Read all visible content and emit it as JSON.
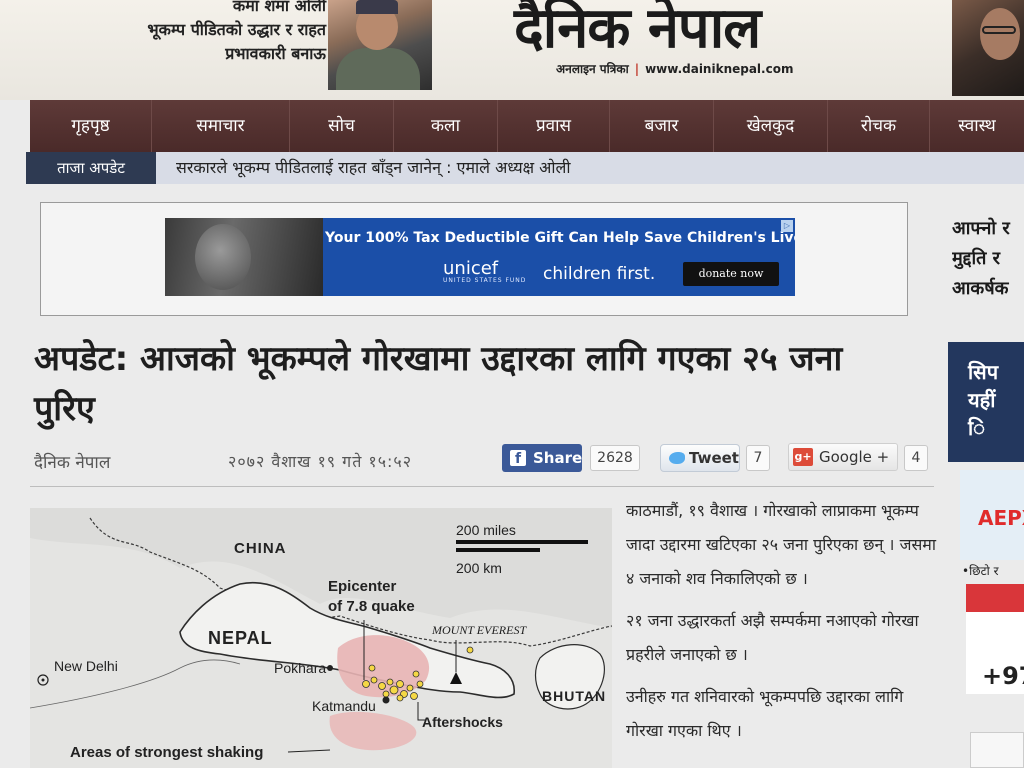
{
  "header": {
    "teaser_line_top": "कमा शमा ओली",
    "teaser_line_1": "भूकम्प पीडितको उद्धार र राहत",
    "teaser_line_2": "प्रभावकारी बनाऊ",
    "logo": "दैनिक नेपाल",
    "tagline_left": "अनलाइन पत्रिका",
    "tagline_sep": "|",
    "tagline_url": "www.dainiknepal.com"
  },
  "nav": {
    "items": [
      "गृहपृष्ठ",
      "समाचार",
      "सोच",
      "कला",
      "प्रवास",
      "बजार",
      "खेलकुद",
      "रोचक",
      "स्वास्थ"
    ]
  },
  "ticker": {
    "label": "ताजा अपडेट",
    "text": "सरकारले भूकम्प पीडितलाई राहत बाँड्न जानेन् : एमाले अध्यक्ष ओली"
  },
  "ad": {
    "headline": "Your 100% Tax Deductible Gift Can Help Save Children's Lives.",
    "brand": "unicef",
    "brand_sub": "UNITED STATES FUND",
    "slogan": "children first.",
    "button": "donate now",
    "choice_icon": "▷"
  },
  "article": {
    "headline": "अपडेट: आजको भूकम्पले गोरखामा उद्दारका लागि गएका २५ जना पुरिए",
    "source": "दैनिक नेपाल",
    "date": "२०७२ वैशाख १९ गते १५:५२",
    "paragraphs": [
      "काठमाडौं, १९ वैशाख । गोरखाको लाप्राकमा भूकम्प जादा उद्दारमा खटिएका २५ जना पुरिएका छन् । जसमा ४ जनाको शव निकालिएको छ ।",
      "२१ जना उद्धारकर्ता अझै सम्पर्कमा नआएको गोरखा प्रहरीले जनाएको छ ।",
      "उनीहरु गत शनिवारको भूकम्पपछि उद्दारका लागि गोरखा गएका थिए ।"
    ]
  },
  "share": {
    "facebook_label": "Share",
    "facebook_icon": "f",
    "facebook_count": "2628",
    "tweet_label": "Tweet",
    "tweet_count": "7",
    "gplus_icon": "g+",
    "gplus_label": "Google +",
    "gplus_count": "4"
  },
  "map": {
    "china": "CHINA",
    "nepal": "NEPAL",
    "new_delhi": "New Delhi",
    "pokhara": "Pokhara",
    "kathmandu": "Katmandu",
    "epicenter_1": "Epicenter",
    "epicenter_2": "of 7.8 quake",
    "everest": "MOUNT EVEREST",
    "aftershocks": "Aftershocks",
    "bhutan": "BHUTAN",
    "shaking": "Areas of strongest shaking",
    "scale_miles": "200 miles",
    "scale_km": "200 km"
  },
  "sidebar": {
    "teaser_1": "आफ्नो र",
    "teaser_2": "मुद्दति र",
    "teaser_3": "आकर्षक",
    "ad1_line1": "सिप",
    "ad1_line2": "यहीं",
    "ad1_line3": "ि",
    "ad2": "AEPX",
    "note": "•छिटो र",
    "ad3": "+97"
  },
  "colors": {
    "nav_bg": "#4a2a29",
    "ticker_label_bg": "#2e3a52",
    "facebook": "#3b5998",
    "twitter": "#55acee",
    "gplus": "#dd4b39",
    "ad_blue": "#1b4fa8",
    "shaking_area": "#e8b4b4"
  }
}
